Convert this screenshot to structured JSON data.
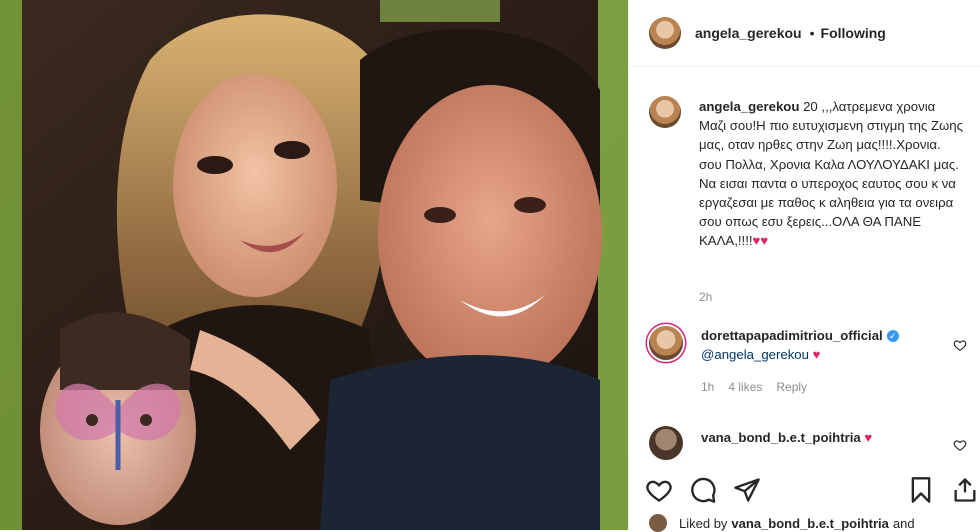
{
  "header": {
    "username": "angela_gerekou",
    "separator": "•",
    "follow_status": "Following"
  },
  "caption": {
    "username": "angela_gerekou",
    "text": " 20 ,,,λατρεμενα χρονια Μαζι σου!Η πιο ευτυχισμενη στιγμη της Ζωης μας, οταν ηρθες στην Ζωη μας!!!!.Χρονια. σου Πολλα, Χρονια Καλα ΛΟΥΛΟΥΔΑΚΙ μας. Να εισαι παντα ο υπεροχος εαυτος σου κ να εργαζεσαι με παθος κ αληθεια για τα ονειρα σου οπως εσυ ξερεις...ΟΛΑ ΘΑ ΠΑΝΕ ΚΑΛΑ,!!!!",
    "hearts": "♥♥",
    "age": "2h"
  },
  "comments": [
    {
      "username": "dorettapapadimitriou_official",
      "mention": "@angela_gerekou",
      "heart": "♥",
      "age": "1h",
      "likes": "4 likes",
      "reply": "Reply"
    },
    {
      "username": "vana_bond_b.e.t_poihtria",
      "heart": "♥"
    }
  ],
  "footer": {
    "liked_by_prefix": "Liked by ",
    "liked_by_user": "vana_bond_b.e.t_poihtria",
    "liked_by_suffix": " and"
  },
  "icons": [
    "heart-icon",
    "comment-icon",
    "share-icon",
    "save-icon",
    "like-icon"
  ],
  "colors": {
    "heart_red": "#e0245e",
    "mention_blue": "#00376b",
    "verified_blue": "#3897f0",
    "muted": "#8e8e8e"
  }
}
